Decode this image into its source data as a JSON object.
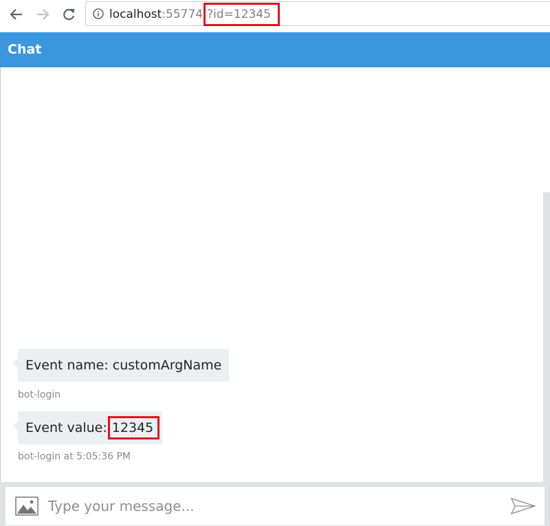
{
  "browser": {
    "url_host": "localhost",
    "url_port": ":55774",
    "url_query": "?id=12345",
    "icons": {
      "back": "arrow-left-icon",
      "forward": "arrow-right-icon",
      "reload": "reload-icon",
      "info": "info-icon"
    }
  },
  "header": {
    "title": "Chat",
    "color": "#3a96dd"
  },
  "messages": [
    {
      "text": "Event name: customArgName",
      "meta": "bot-login"
    },
    {
      "prefix": "Event value:",
      "value": "12345",
      "meta": "bot-login at 5:05:36 PM"
    }
  ],
  "input": {
    "placeholder": "Type your message...",
    "icons": {
      "upload": "image-upload-icon",
      "send": "send-icon"
    }
  },
  "colors": {
    "highlight": "#e0141e",
    "bubble": "#eceff1"
  }
}
